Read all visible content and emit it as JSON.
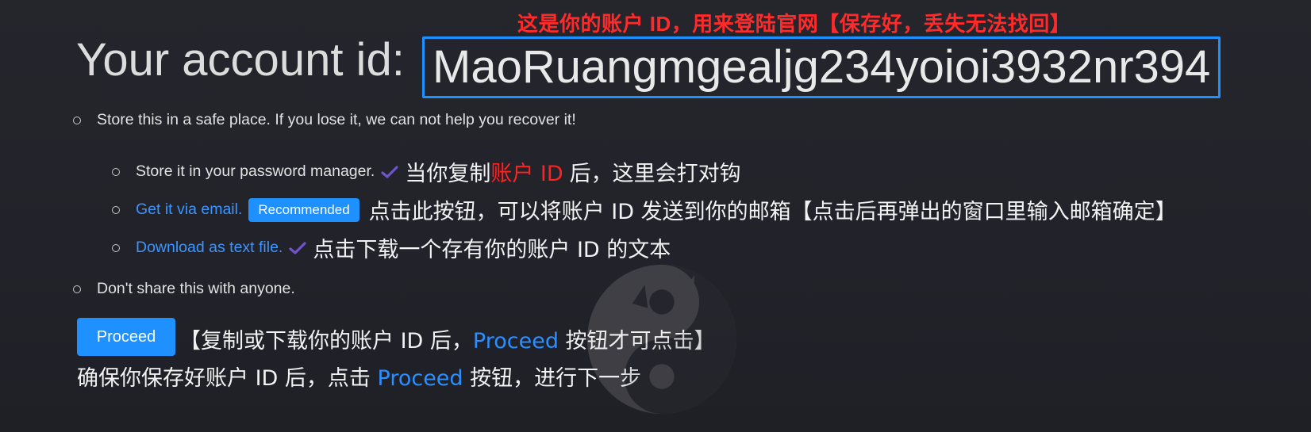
{
  "annotations": {
    "top": "这是你的账户 ID，用来登陆官网【保存好，丢失无法找回】"
  },
  "account": {
    "label": "Your account id:",
    "id": "MaoRuangmgealjg234yoioi3932nr394"
  },
  "bullets": {
    "store_safe": "Store this in a safe place. If you lose it, we can not help you recover it!",
    "password_manager": "Store it in your password manager.",
    "password_manager_note_prefix": "当你复制",
    "password_manager_note_highlight": "账户 ID",
    "password_manager_note_suffix": "后，这里会打对钩",
    "email_link": "Get it via email.",
    "email_badge": "Recommended",
    "email_note": "点击此按钮，可以将账户 ID 发送到你的邮箱【点击后再弹出的窗口里输入邮箱确定】",
    "download_link": "Download as text file.",
    "download_note": "点击下载一个存有你的账户 ID 的文本",
    "dont_share": "Don't share this with anyone."
  },
  "proceed": {
    "button_label": "Proceed",
    "note_prefix": "【复制或下载你的账户 ID 后，",
    "note_highlight": "Proceed",
    "note_suffix": " 按钮才可点击】",
    "line2_prefix": "确保你保存好账户 ID 后，点击 ",
    "line2_highlight": "Proceed",
    "line2_suffix": " 按钮，进行下一步"
  },
  "icons": {
    "check": "check-icon",
    "bullet": "circle-bullet-icon",
    "watermark": "cat-yin-yang-watermark"
  },
  "colors": {
    "accent_blue": "#1e90ff",
    "annotation_red": "#ff2222",
    "check_purple": "#6f55c8",
    "background": "#23232a"
  }
}
